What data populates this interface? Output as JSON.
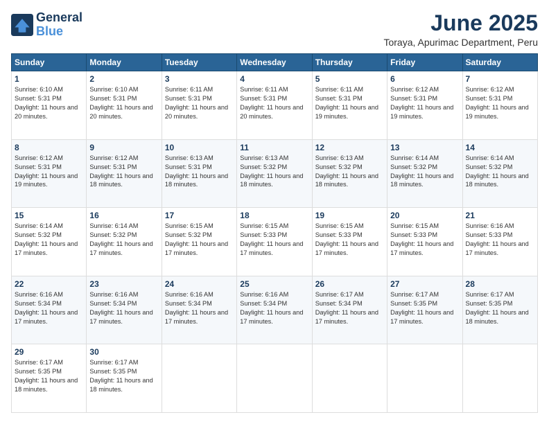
{
  "logo": {
    "line1": "General",
    "line2": "Blue"
  },
  "title": "June 2025",
  "subtitle": "Toraya, Apurimac Department, Peru",
  "days_header": [
    "Sunday",
    "Monday",
    "Tuesday",
    "Wednesday",
    "Thursday",
    "Friday",
    "Saturday"
  ],
  "weeks": [
    [
      {
        "day": "1",
        "sunrise": "6:10 AM",
        "sunset": "5:31 PM",
        "daylight": "11 hours and 20 minutes."
      },
      {
        "day": "2",
        "sunrise": "6:10 AM",
        "sunset": "5:31 PM",
        "daylight": "11 hours and 20 minutes."
      },
      {
        "day": "3",
        "sunrise": "6:11 AM",
        "sunset": "5:31 PM",
        "daylight": "11 hours and 20 minutes."
      },
      {
        "day": "4",
        "sunrise": "6:11 AM",
        "sunset": "5:31 PM",
        "daylight": "11 hours and 20 minutes."
      },
      {
        "day": "5",
        "sunrise": "6:11 AM",
        "sunset": "5:31 PM",
        "daylight": "11 hours and 19 minutes."
      },
      {
        "day": "6",
        "sunrise": "6:12 AM",
        "sunset": "5:31 PM",
        "daylight": "11 hours and 19 minutes."
      },
      {
        "day": "7",
        "sunrise": "6:12 AM",
        "sunset": "5:31 PM",
        "daylight": "11 hours and 19 minutes."
      }
    ],
    [
      {
        "day": "8",
        "sunrise": "6:12 AM",
        "sunset": "5:31 PM",
        "daylight": "11 hours and 19 minutes."
      },
      {
        "day": "9",
        "sunrise": "6:12 AM",
        "sunset": "5:31 PM",
        "daylight": "11 hours and 18 minutes."
      },
      {
        "day": "10",
        "sunrise": "6:13 AM",
        "sunset": "5:31 PM",
        "daylight": "11 hours and 18 minutes."
      },
      {
        "day": "11",
        "sunrise": "6:13 AM",
        "sunset": "5:32 PM",
        "daylight": "11 hours and 18 minutes."
      },
      {
        "day": "12",
        "sunrise": "6:13 AM",
        "sunset": "5:32 PM",
        "daylight": "11 hours and 18 minutes."
      },
      {
        "day": "13",
        "sunrise": "6:14 AM",
        "sunset": "5:32 PM",
        "daylight": "11 hours and 18 minutes."
      },
      {
        "day": "14",
        "sunrise": "6:14 AM",
        "sunset": "5:32 PM",
        "daylight": "11 hours and 18 minutes."
      }
    ],
    [
      {
        "day": "15",
        "sunrise": "6:14 AM",
        "sunset": "5:32 PM",
        "daylight": "11 hours and 17 minutes."
      },
      {
        "day": "16",
        "sunrise": "6:14 AM",
        "sunset": "5:32 PM",
        "daylight": "11 hours and 17 minutes."
      },
      {
        "day": "17",
        "sunrise": "6:15 AM",
        "sunset": "5:32 PM",
        "daylight": "11 hours and 17 minutes."
      },
      {
        "day": "18",
        "sunrise": "6:15 AM",
        "sunset": "5:33 PM",
        "daylight": "11 hours and 17 minutes."
      },
      {
        "day": "19",
        "sunrise": "6:15 AM",
        "sunset": "5:33 PM",
        "daylight": "11 hours and 17 minutes."
      },
      {
        "day": "20",
        "sunrise": "6:15 AM",
        "sunset": "5:33 PM",
        "daylight": "11 hours and 17 minutes."
      },
      {
        "day": "21",
        "sunrise": "6:16 AM",
        "sunset": "5:33 PM",
        "daylight": "11 hours and 17 minutes."
      }
    ],
    [
      {
        "day": "22",
        "sunrise": "6:16 AM",
        "sunset": "5:34 PM",
        "daylight": "11 hours and 17 minutes."
      },
      {
        "day": "23",
        "sunrise": "6:16 AM",
        "sunset": "5:34 PM",
        "daylight": "11 hours and 17 minutes."
      },
      {
        "day": "24",
        "sunrise": "6:16 AM",
        "sunset": "5:34 PM",
        "daylight": "11 hours and 17 minutes."
      },
      {
        "day": "25",
        "sunrise": "6:16 AM",
        "sunset": "5:34 PM",
        "daylight": "11 hours and 17 minutes."
      },
      {
        "day": "26",
        "sunrise": "6:17 AM",
        "sunset": "5:34 PM",
        "daylight": "11 hours and 17 minutes."
      },
      {
        "day": "27",
        "sunrise": "6:17 AM",
        "sunset": "5:35 PM",
        "daylight": "11 hours and 17 minutes."
      },
      {
        "day": "28",
        "sunrise": "6:17 AM",
        "sunset": "5:35 PM",
        "daylight": "11 hours and 18 minutes."
      }
    ],
    [
      {
        "day": "29",
        "sunrise": "6:17 AM",
        "sunset": "5:35 PM",
        "daylight": "11 hours and 18 minutes."
      },
      {
        "day": "30",
        "sunrise": "6:17 AM",
        "sunset": "5:35 PM",
        "daylight": "11 hours and 18 minutes."
      },
      null,
      null,
      null,
      null,
      null
    ]
  ]
}
